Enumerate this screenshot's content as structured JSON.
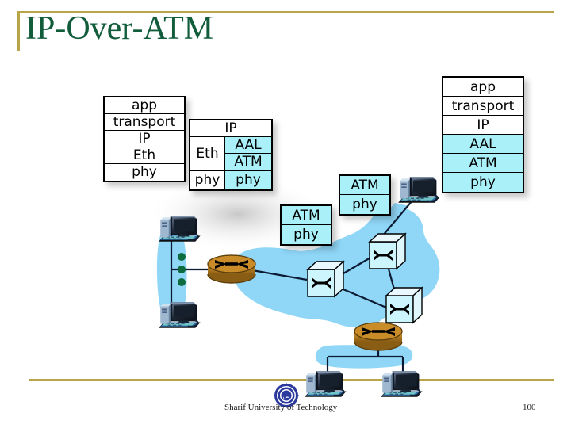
{
  "slide": {
    "title": "IP-Over-ATM",
    "accent_gold": "#b9a448",
    "title_green": "#115c3b",
    "highlight_cyan": "#aaf0f8"
  },
  "host_left_stack": {
    "name": "Ethernet host protocol stack",
    "layers": [
      {
        "label": "app",
        "highlight": false
      },
      {
        "label": "transport",
        "highlight": false
      },
      {
        "label": "IP",
        "highlight": false
      },
      {
        "label": "Eth",
        "highlight": false
      },
      {
        "label": "phy",
        "highlight": false
      }
    ]
  },
  "router_stack": {
    "name": "Edge router protocol stack",
    "top": "IP",
    "left_column": [
      "Eth",
      "phy"
    ],
    "right_column": [
      "AAL",
      "ATM",
      "phy"
    ]
  },
  "switch_stack_a": {
    "name": "ATM switch protocol stack",
    "layers": [
      {
        "label": "ATM",
        "highlight": true
      },
      {
        "label": "phy",
        "highlight": true
      }
    ]
  },
  "switch_stack_b": {
    "name": "ATM switch protocol stack",
    "layers": [
      {
        "label": "ATM",
        "highlight": true
      },
      {
        "label": "phy",
        "highlight": true
      }
    ]
  },
  "host_right_stack": {
    "name": "ATM host protocol stack",
    "layers": [
      {
        "label": "app",
        "highlight": false
      },
      {
        "label": "transport",
        "highlight": false
      },
      {
        "label": "IP",
        "highlight": false
      },
      {
        "label": "AAL",
        "highlight": true
      },
      {
        "label": "ATM",
        "highlight": true
      },
      {
        "label": "phy",
        "highlight": true
      }
    ]
  },
  "diagram": {
    "cloud_color": "#8fd6f7",
    "switch_fill": "#ccf5fd",
    "router_fill": "#b07a20",
    "dot_color": "#0e6b3d",
    "nodes": [
      {
        "type": "workstation",
        "name": "lan-host-top"
      },
      {
        "type": "workstation",
        "name": "lan-host-bottom"
      },
      {
        "type": "ellipsis-dots",
        "name": "lan-more-hosts",
        "count": 3
      },
      {
        "type": "router",
        "name": "edge-router-left"
      },
      {
        "type": "atm-switch",
        "name": "atm-switch-center"
      },
      {
        "type": "atm-switch",
        "name": "atm-switch-upper-right"
      },
      {
        "type": "atm-switch",
        "name": "atm-switch-lower-right"
      },
      {
        "type": "router",
        "name": "edge-router-bottom"
      },
      {
        "type": "workstation",
        "name": "bottom-host-left"
      },
      {
        "type": "workstation",
        "name": "bottom-host-right"
      },
      {
        "type": "workstation",
        "name": "atm-host-right"
      }
    ]
  },
  "footer": {
    "organization": "Sharif University of Technology",
    "page_number": "100"
  }
}
